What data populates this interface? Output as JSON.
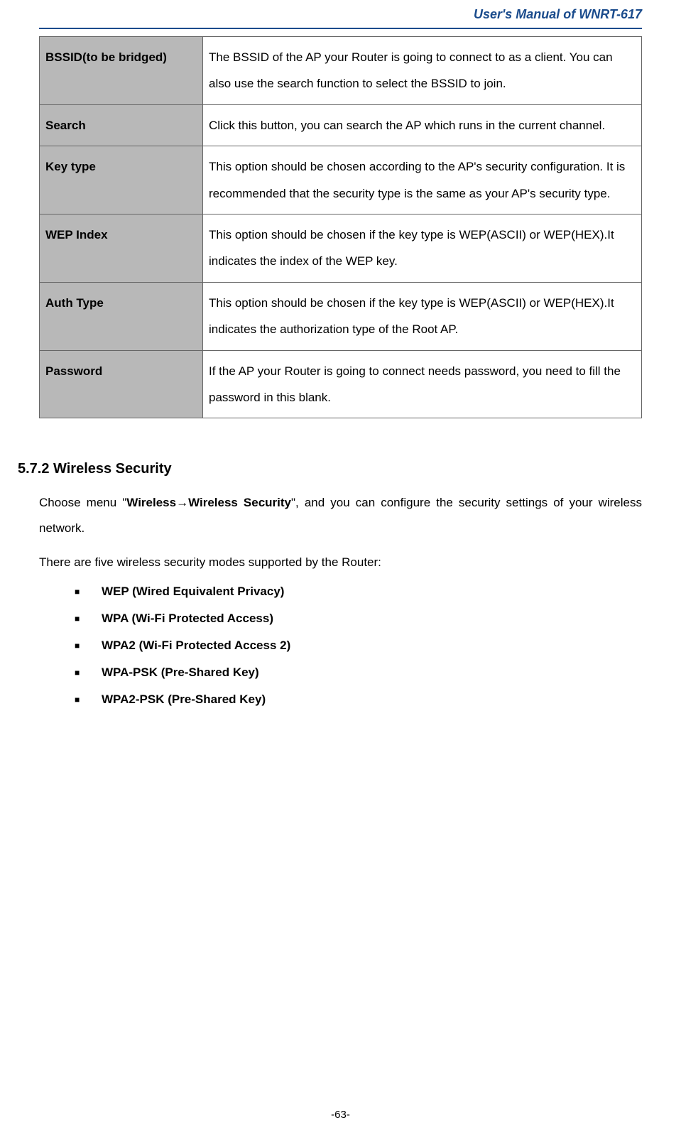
{
  "header": {
    "title": "User's Manual of WNRT-617"
  },
  "table": {
    "rows": [
      {
        "label": "BSSID(to be bridged)",
        "desc": "The BSSID of the AP your Router is going to connect to as a client. You can also use the search function to select the BSSID to join."
      },
      {
        "label": "Search",
        "desc": "Click this button, you can search the AP which runs in the current channel."
      },
      {
        "label": "Key type",
        "desc": "This option should be chosen according to the AP's security configuration. It is recommended that the security type is the same as your AP's security type."
      },
      {
        "label": "WEP Index",
        "desc": "This option should be chosen if the key type is WEP(ASCII) or WEP(HEX).It indicates the index of the WEP key."
      },
      {
        "label": "Auth Type",
        "desc": "This option should be chosen if the key type is WEP(ASCII) or WEP(HEX).It indicates the authorization type of the Root AP."
      },
      {
        "label": "Password",
        "desc": "If the AP your Router is going to connect needs password, you need to fill the password in this blank."
      }
    ]
  },
  "section": {
    "heading": "5.7.2   Wireless Security",
    "intro_prefix": "Choose menu \"",
    "intro_bold1": "Wireless",
    "intro_arrow": "→",
    "intro_bold2": "Wireless Security",
    "intro_suffix": "\", and you can configure the security settings of your wireless network.",
    "line2": "There are five wireless security modes supported by the Router:",
    "modes": [
      "WEP (Wired Equivalent Privacy)",
      "WPA (Wi-Fi Protected Access)",
      "WPA2 (Wi-Fi Protected Access 2)",
      "WPA-PSK (Pre-Shared Key)",
      "WPA2-PSK (Pre-Shared Key)"
    ]
  },
  "footer": {
    "page": "-63-"
  }
}
